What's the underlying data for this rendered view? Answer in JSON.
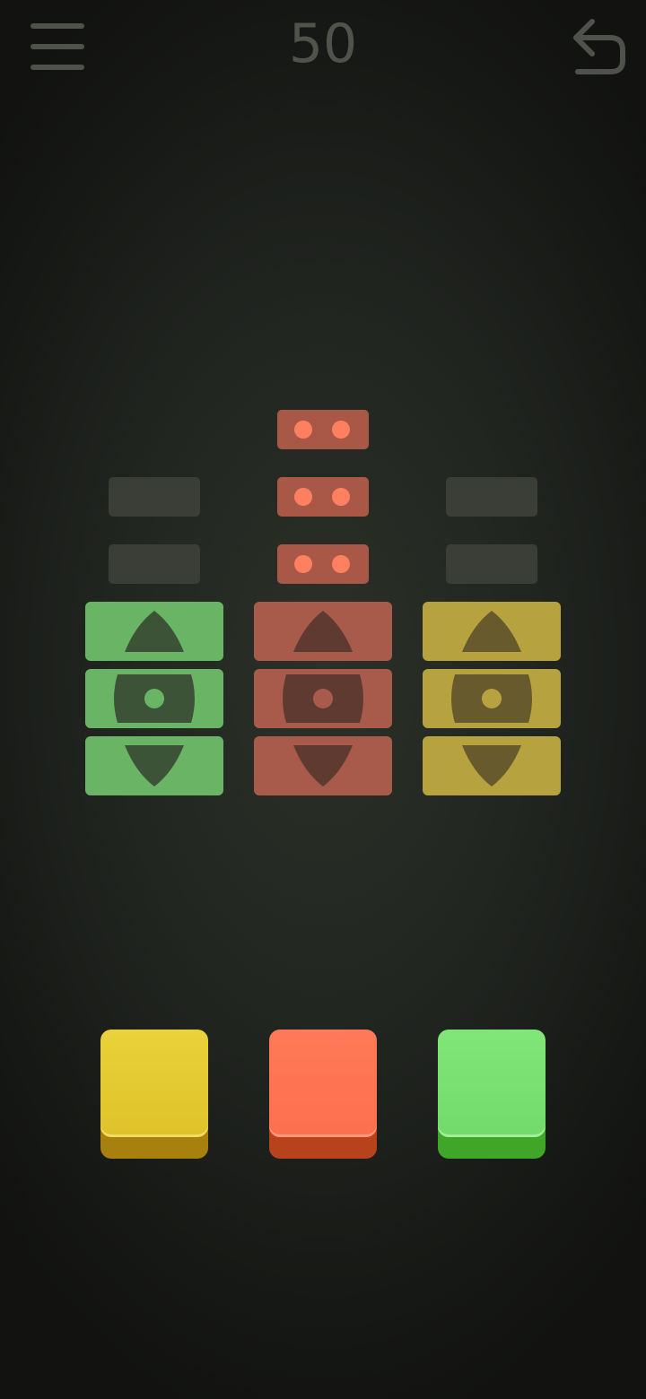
{
  "header": {
    "score": "50",
    "menu_icon": "hamburger-menu-icon",
    "undo_icon": "undo-arrow-icon"
  },
  "colors": {
    "green": "#6ab466",
    "red": "#a95b4b",
    "yellow": "#b6a23e",
    "slot_empty": "#3a3e37",
    "slot_filled": "#a95848",
    "dot": "#ff8060"
  },
  "columns": [
    {
      "id": "green",
      "tile_color": "#6ab466",
      "shape_color": "#3c5338",
      "slots": [
        "empty",
        "empty"
      ]
    },
    {
      "id": "red",
      "tile_color": "#a95b4b",
      "shape_color": "#5e3a30",
      "slots": [
        "filled",
        "filled",
        "filled"
      ]
    },
    {
      "id": "yellow",
      "tile_color": "#b6a23e",
      "shape_color": "#675a2c",
      "slots": [
        "empty",
        "empty"
      ]
    }
  ],
  "buttons": [
    {
      "id": "yellow",
      "face": "#e4c52c",
      "edge": "#a7800d"
    },
    {
      "id": "red",
      "face": "#ff7352",
      "edge": "#b8421c"
    },
    {
      "id": "green",
      "face": "#78e070",
      "edge": "#3fa62a"
    }
  ]
}
